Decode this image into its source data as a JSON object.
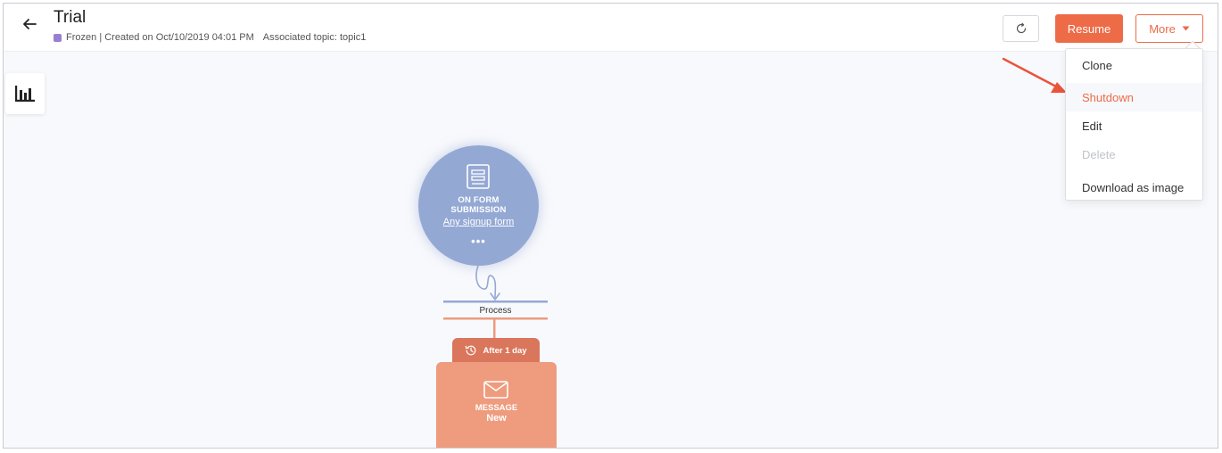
{
  "header": {
    "title": "Trial",
    "status": "Frozen",
    "created": "| Created on Oct/10/2019 04:01 PM",
    "topic": "Associated topic: topic1"
  },
  "toolbar": {
    "resume_label": "Resume",
    "more_label": "More"
  },
  "more_menu": {
    "items": [
      {
        "label": "Clone",
        "state": "normal"
      },
      {
        "label": "Shutdown",
        "state": "highlighted"
      },
      {
        "label": "Edit",
        "state": "normal"
      },
      {
        "label": "Delete",
        "state": "disabled"
      },
      {
        "label": "Download as image",
        "state": "normal"
      }
    ]
  },
  "workflow": {
    "trigger": {
      "title": "ON FORM SUBMISSION",
      "link": "Any signup form",
      "more": "•••"
    },
    "process_label": "Process",
    "delay_label": "After 1 day",
    "message": {
      "type": "MESSAGE",
      "name": "New"
    }
  },
  "icons": {
    "back": "arrow-left-icon",
    "refresh": "refresh-icon",
    "dropdown": "caret-down-icon",
    "stats": "bar-chart-icon",
    "form": "form-icon",
    "clock": "history-clock-icon",
    "envelope": "envelope-icon"
  },
  "colors": {
    "accent": "#ee6b48",
    "status_frozen": "#9a7fd1",
    "trigger_node": "#94a8d4",
    "message_node": "#ee9b7e",
    "delay_tab": "#d9765c",
    "annotation_arrow": "#e9543a"
  }
}
